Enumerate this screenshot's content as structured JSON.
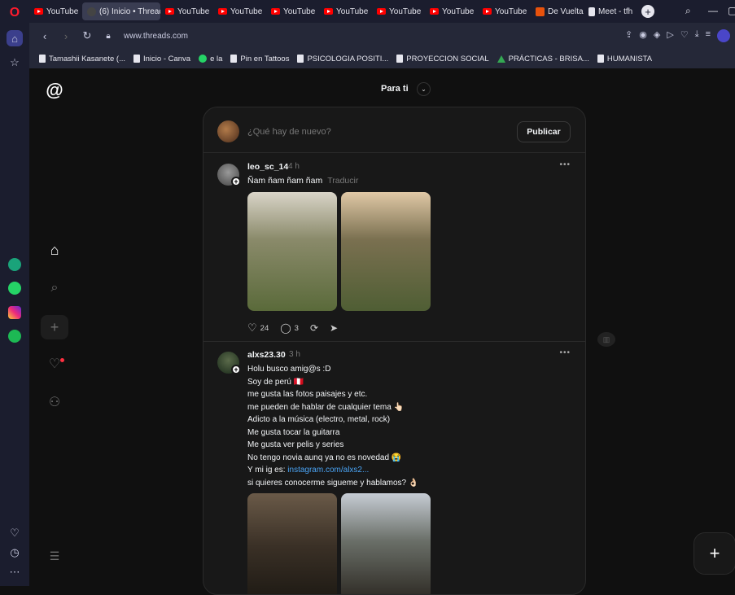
{
  "browser": {
    "tabs": [
      {
        "label": "YouTube",
        "kind": "youtube"
      },
      {
        "label": "(6) Inicio • Threads",
        "kind": "threads",
        "active": true
      },
      {
        "label": "YouTube",
        "kind": "youtube"
      },
      {
        "label": "YouTube",
        "kind": "youtube"
      },
      {
        "label": "YouTube",
        "kind": "youtube"
      },
      {
        "label": "YouTube",
        "kind": "youtube"
      },
      {
        "label": "YouTube",
        "kind": "youtube"
      },
      {
        "label": "YouTube",
        "kind": "youtube"
      },
      {
        "label": "YouTube",
        "kind": "youtube"
      },
      {
        "label": "De Vuelta",
        "kind": "other"
      },
      {
        "label": "Meet - tfh",
        "kind": "doc"
      }
    ],
    "url": "www.threads.com",
    "bookmarks": [
      {
        "label": "Tamashii Kasanete (...",
        "icon": "doc"
      },
      {
        "label": "Inicio - Canva",
        "icon": "doc"
      },
      {
        "label": "e la",
        "icon": "whatsapp"
      },
      {
        "label": "Pin en Tattoos",
        "icon": "doc"
      },
      {
        "label": "PSICOLOGIA POSITI...",
        "icon": "doc"
      },
      {
        "label": "PROYECCION SOCIAL",
        "icon": "doc"
      },
      {
        "label": "PRÁCTICAS - BRISA...",
        "icon": "drive"
      },
      {
        "label": "HUMANISTA",
        "icon": "doc"
      }
    ]
  },
  "threads": {
    "feed_title": "Para ti",
    "composer": {
      "placeholder": "¿Qué hay de nuevo?",
      "publish_label": "Publicar"
    },
    "posts": [
      {
        "username": "leo_sc_14",
        "time": "4 h",
        "text": "Ñam ñam ñam ñam",
        "translate": "Traducir",
        "likes": "24",
        "comments": "3"
      },
      {
        "username": "alxs23.30",
        "time": "3 h",
        "lines": [
          "Holu busco amig@s :D",
          "Soy de perú 🇵🇪",
          "me gusta las fotos paisajes y etc.",
          "me pueden de hablar de cualquier tema 👆🏻",
          "Adicto a la música (electro, metal, rock)",
          "Me gusta tocar la guitarra",
          "Me gusta ver pelis y series",
          "No tengo novia aunq ya no es novedad 😭"
        ],
        "ig_prefix": "Y mi ig es: ",
        "ig_link": "instagram.com/alxs2...",
        "last_line": "si quieres conocerme sigueme y hablamos? 👌🏻"
      }
    ]
  }
}
